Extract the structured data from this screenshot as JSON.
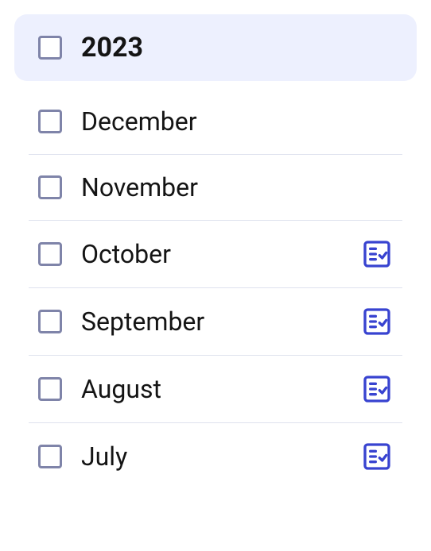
{
  "year": {
    "label": "2023",
    "checked": false
  },
  "months": [
    {
      "label": "December",
      "checked": false,
      "has_records": false
    },
    {
      "label": "November",
      "checked": false,
      "has_records": false
    },
    {
      "label": "October",
      "checked": false,
      "has_records": true
    },
    {
      "label": "September",
      "checked": false,
      "has_records": true
    },
    {
      "label": "August",
      "checked": false,
      "has_records": true
    },
    {
      "label": "July",
      "checked": false,
      "has_records": true
    }
  ],
  "colors": {
    "accent": "#3843d0",
    "header_bg": "#edf0fe",
    "checkbox_border": "#7f84a9",
    "divider": "#dfe2ee"
  }
}
